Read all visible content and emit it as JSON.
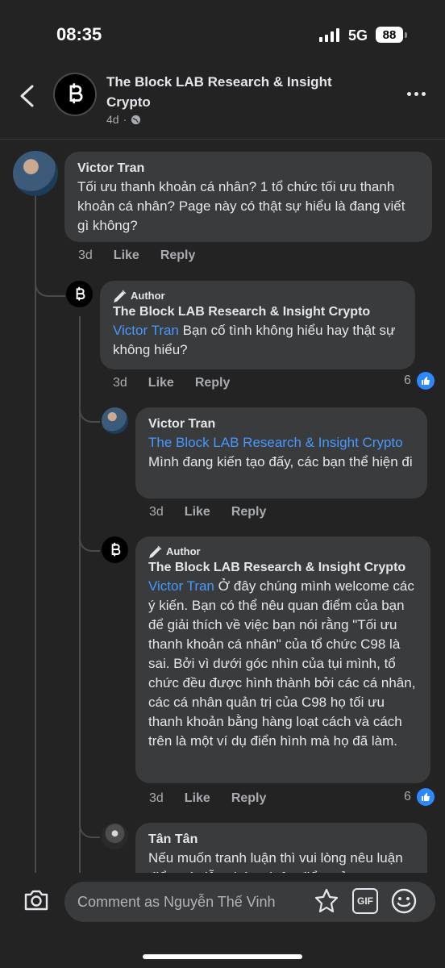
{
  "status": {
    "time": "08:35",
    "network": "5G",
    "battery": "88"
  },
  "header": {
    "title": "The Block LAB Research & Insight Crypto",
    "age": "4d"
  },
  "comments": [
    {
      "name": "Victor Tran",
      "text": "Tối ưu thanh khoản cá nhân? 1 tổ chức tối ưu thanh khoản cá nhân? Page này có thật sự hiểu là đang viết gì không?",
      "time": "3d",
      "like": "Like",
      "reply": "Reply"
    },
    {
      "badge": "Author",
      "name": "The Block LAB Research & Insight Crypto",
      "mention": "Victor Tran",
      "text": "Bạn cố tình không hiểu hay thật sự không hiểu?",
      "time": "3d",
      "like": "Like",
      "reply": "Reply",
      "reactions": "6"
    },
    {
      "name": "Victor Tran",
      "mention": "The Block LAB Research & Insight Crypto",
      "text": "Mình đang kiến tạo đấy, các bạn thể hiện đi",
      "time": "3d",
      "like": "Like",
      "reply": "Reply"
    },
    {
      "badge": "Author",
      "name": "The Block LAB Research & Insight Crypto",
      "mention": "Victor Tran",
      "text": "Ở đây chúng mình welcome các ý kiến. Bạn có thể nêu quan điểm của bạn để giải thích về việc bạn nói rằng \"Tối ưu thanh khoản cá nhân\" của tổ chức C98 là sai. Bởi vì dưới góc nhìn của tụi mình, tổ chức đều được hình thành bởi các cá nhân, các cá nhân quản trị của C98 họ tối ưu thanh khoản bằng hàng loạt cách và cách trên là một ví dụ điển hình mà họ đã làm.",
      "time": "3d",
      "like": "Like",
      "reply": "Reply",
      "reactions": "6"
    },
    {
      "name": "Tân Tân",
      "text": "Nếu muốn tranh luận thì vui lòng nêu luận điểm và dẫn chứng luận điểm của"
    }
  ],
  "composer": {
    "placeholder": "Comment as Nguyễn Thế Vinh",
    "gif": "GIF"
  },
  "colors": {
    "background": "#232324",
    "bubble": "#3a3b3c",
    "mention": "#4599ff",
    "like": "#2d88ff"
  },
  "icons": [
    "back-arrow-icon",
    "block-logo-icon",
    "globe-icon",
    "more-icon",
    "pen-icon",
    "like-icon",
    "camera-icon",
    "sticker-icon",
    "gif-icon",
    "emoji-icon"
  ]
}
